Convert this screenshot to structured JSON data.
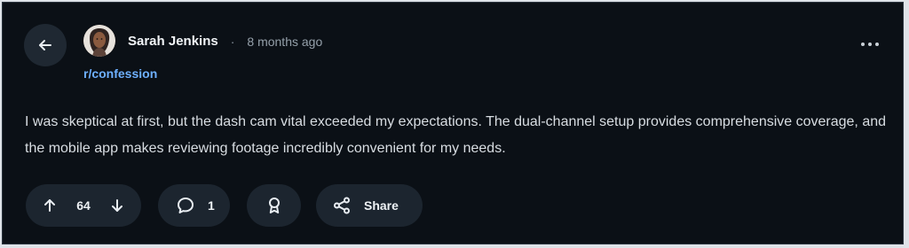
{
  "post": {
    "author": "Sarah Jenkins",
    "separator": "·",
    "time": "8 months ago",
    "community": "r/confession",
    "text": "I was skeptical at first, but the dash cam vital exceeded my expectations. The dual-channel setup provides comprehensive coverage, and the mobile app makes reviewing footage incredibly convenient for my needs."
  },
  "actions": {
    "upvotes": "64",
    "comments": "1",
    "share_label": "Share"
  },
  "icons": {
    "back": "arrow-left-icon",
    "more": "more-horizontal-icon",
    "upvote": "arrow-up-icon",
    "downvote": "arrow-down-icon",
    "comment": "comment-bubble-icon",
    "award": "award-icon",
    "share": "share-icon"
  },
  "colors": {
    "background": "#0b1016",
    "pill": "#1c252f",
    "text": "#d8dde2",
    "community": "#6eb0ff"
  }
}
